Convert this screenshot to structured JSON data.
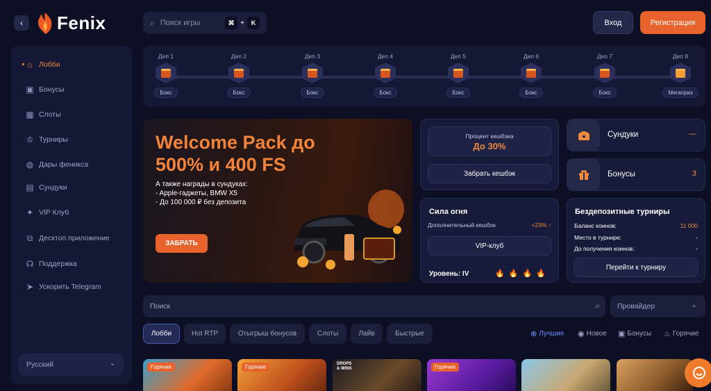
{
  "brand": {
    "name": "Fenix",
    "accent": "#e8622c"
  },
  "header": {
    "search_placeholder": "Поиск игры",
    "shortcut_key1": "⌘",
    "shortcut_plus": "+",
    "shortcut_key2": "K",
    "login": "Вход",
    "register": "Регистрация"
  },
  "sidebar": {
    "items": [
      {
        "label": "Лобби",
        "icon": "home-icon"
      },
      {
        "label": "Бонусы",
        "icon": "gift-icon"
      },
      {
        "label": "Слоты",
        "icon": "grid-icon"
      },
      {
        "label": "Турниры",
        "icon": "trophy-icon"
      },
      {
        "label": "Дары феникса",
        "icon": "ball-icon"
      },
      {
        "label": "Сундуки",
        "icon": "chest-icon"
      },
      {
        "label": "VIP Клуб",
        "icon": "sparkle-icon"
      },
      {
        "label": "Десктоп приложение",
        "icon": "external-icon"
      },
      {
        "label": "Поддержка",
        "icon": "headset-icon"
      },
      {
        "label": "Ускорить Telegram",
        "icon": "telegram-icon"
      }
    ],
    "language": "Русский"
  },
  "days": [
    {
      "label": "Деп 1",
      "reward": "Бокс"
    },
    {
      "label": "Деп 2",
      "reward": "Бокс"
    },
    {
      "label": "Деп 3",
      "reward": "Бокс"
    },
    {
      "label": "Деп 4",
      "reward": "Бокс"
    },
    {
      "label": "Деп 5",
      "reward": "Бокс"
    },
    {
      "label": "Деп 6",
      "reward": "Бокс"
    },
    {
      "label": "Деп 7",
      "reward": "Бокс"
    },
    {
      "label": "Деп 8",
      "reward": "Мегаприз"
    }
  ],
  "banner": {
    "title": "Welcome Pack до 500% и 400 FS",
    "sub1": "А также награды в сундуках:",
    "sub2": "- Apple-гаджеты, BMW X5",
    "sub3": "- До 100 000 ₽ без депозита",
    "cta": "ЗАБРАТЬ"
  },
  "cashback": {
    "label": "Процент кешбэка",
    "value": "До 30%",
    "button": "Забрать кешбэк"
  },
  "fire": {
    "title": "Сила огня",
    "extra_label": "Дополнительный кешбэк",
    "extra_value": "+23% ↑",
    "button": "VIP-клуб",
    "level": "Уровень: IV"
  },
  "chests": {
    "label": "Сундуки",
    "value": "—"
  },
  "bonuses": {
    "label": "Бонусы",
    "value": "3"
  },
  "tournaments": {
    "title": "Бездепозитные турниры",
    "coins_label": "Баланс коинов:",
    "coins_value": "11 000",
    "place_label": "Место в турнире:",
    "place_value": "-",
    "until_label": "До получения коинов:",
    "until_value": "-",
    "button": "Перейти к турниру"
  },
  "games": {
    "search_placeholder": "Поиск",
    "provider": "Провайдер",
    "tabs": [
      "Лобби",
      "Hot RTP",
      "Отыгрыш бонусов",
      "Слоты",
      "Лайв",
      "Быстрые"
    ],
    "sorts": [
      "Лучшие",
      "Новое",
      "Бонусы",
      "Горячие"
    ],
    "hot_badge": "Горячие",
    "drops_badge": "DROPS & WINS"
  }
}
